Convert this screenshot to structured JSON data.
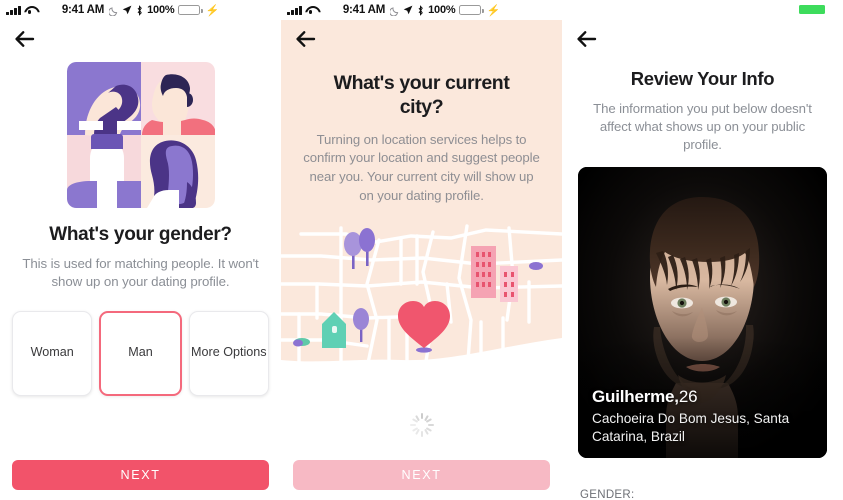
{
  "statusbar": {
    "time": "9:41 AM",
    "battery_percent": "100%",
    "signal_icon": "cellular-signal-icon",
    "wifi_icon": "wifi-icon",
    "dnd_icon": "moon-do-not-disturb-icon",
    "location_icon": "location-arrow-icon",
    "bluetooth_icon": "bluetooth-icon",
    "battery_icon": "battery-icon",
    "charging_icon": "charging-bolt-icon",
    "accent_green": "#37D651"
  },
  "screen1": {
    "back_icon": "back-arrow-icon",
    "illustration_name": "gender-collage-illustration",
    "title": "What's your gender?",
    "subtitle": "This is used for matching people. It won't show up on your dating profile.",
    "options": [
      {
        "label": "Woman",
        "selected": false
      },
      {
        "label": "Man",
        "selected": true
      },
      {
        "label": "More Options",
        "selected": false
      }
    ],
    "next_label": "NEXT",
    "next_color": "#F2536A",
    "selected_border_color": "#F4697C"
  },
  "screen2": {
    "back_icon": "back-arrow-icon",
    "title": "What's your current city?",
    "subtitle": "Turning on location services helps to confirm your location and suggest people near you. Your current city will show up on your dating profile.",
    "illustration_name": "city-map-illustration",
    "spinner_name": "loading-spinner",
    "next_label": "NEXT",
    "next_disabled": true,
    "background_color": "#FBE8DC",
    "heart_color": "#F0566E"
  },
  "screen3": {
    "back_icon": "back-arrow-icon",
    "title": "Review Your Info",
    "subtitle": "The information you put below doesn't affect what shows up on your public profile.",
    "profile": {
      "photo_name": "profile-photo",
      "name": "Guilherme",
      "age": "26",
      "name_separator": ",",
      "location": "Cachoeira Do Bom Jesus, Santa Catarina, Brazil"
    },
    "gender_field_label": "GENDER:"
  }
}
